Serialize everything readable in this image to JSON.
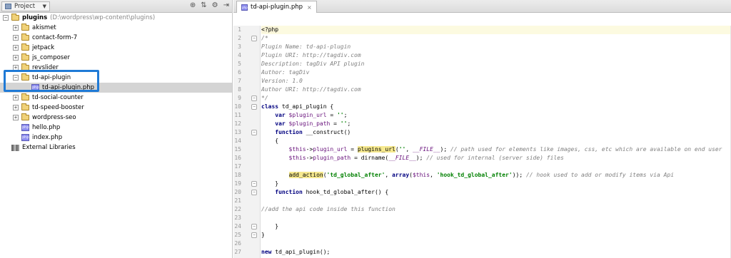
{
  "project_panel": {
    "title": "Project",
    "tree": [
      {
        "label": "plugins",
        "path": "(D:\\wordpress\\wp-content\\plugins)",
        "type": "folder",
        "expand": "-",
        "level": 0,
        "bold": true
      },
      {
        "label": "akismet",
        "type": "folder",
        "expand": "+",
        "level": 1
      },
      {
        "label": "contact-form-7",
        "type": "folder",
        "expand": "+",
        "level": 1
      },
      {
        "label": "jetpack",
        "type": "folder",
        "expand": "+",
        "level": 1
      },
      {
        "label": "js_composer",
        "type": "folder",
        "expand": "+",
        "level": 1
      },
      {
        "label": "revslider",
        "type": "folder",
        "expand": "+",
        "level": 1
      },
      {
        "label": "td-api-plugin",
        "type": "folder",
        "expand": "-",
        "level": 1
      },
      {
        "label": "td-api-plugin.php",
        "type": "php",
        "expand": "",
        "level": 2,
        "selected": true
      },
      {
        "label": "td-social-counter",
        "type": "folder",
        "expand": "+",
        "level": 1
      },
      {
        "label": "td-speed-booster",
        "type": "folder",
        "expand": "+",
        "level": 1
      },
      {
        "label": "wordpress-seo",
        "type": "folder",
        "expand": "+",
        "level": 1
      },
      {
        "label": "hello.php",
        "type": "php",
        "expand": "",
        "level": 1
      },
      {
        "label": "index.php",
        "type": "php",
        "expand": "",
        "level": 1
      },
      {
        "label": "External Libraries",
        "type": "lib",
        "expand": "",
        "level": 0
      }
    ]
  },
  "editor": {
    "tab_label": "td-api-plugin.php",
    "lines": [
      {
        "n": "1",
        "fold": "",
        "html": "<span class=\"phptag\">&lt;?php</span>"
      },
      {
        "n": "2",
        "fold": "-",
        "html": "<span class=\"cmt\">/*</span>"
      },
      {
        "n": "3",
        "fold": "",
        "html": "<span class=\"cmt\">Plugin Name: td-api-plugin</span>"
      },
      {
        "n": "4",
        "fold": "",
        "html": "<span class=\"cmt\">Plugin URI: http://tagdiv.com</span>"
      },
      {
        "n": "5",
        "fold": "",
        "html": "<span class=\"cmt\">Description: tagDiv API plugin</span>"
      },
      {
        "n": "6",
        "fold": "",
        "html": "<span class=\"cmt\">Author: tagDiv</span>"
      },
      {
        "n": "7",
        "fold": "",
        "html": "<span class=\"cmt\">Version: 1.0</span>"
      },
      {
        "n": "8",
        "fold": "",
        "html": "<span class=\"cmt\">Author URI: http://tagdiv.com</span>"
      },
      {
        "n": "9",
        "fold": "-",
        "html": "<span class=\"cmt\">*/</span>"
      },
      {
        "n": "10",
        "fold": "-",
        "html": "<span class=\"kw\">class</span> td_api_plugin {"
      },
      {
        "n": "11",
        "fold": "",
        "html": "    <span class=\"kw\">var</span> <span class=\"var\">$plugin_url</span> = <span class=\"str\">''</span>;"
      },
      {
        "n": "12",
        "fold": "",
        "html": "    <span class=\"kw\">var</span> <span class=\"var\">$plugin_path</span> = <span class=\"str\">''</span>;"
      },
      {
        "n": "13",
        "fold": "-",
        "html": "    <span class=\"kw\">function</span> __construct()"
      },
      {
        "n": "14",
        "fold": "",
        "html": "    {"
      },
      {
        "n": "15",
        "fold": "",
        "html": "        <span class=\"var\">$this</span>-&gt;<span class=\"var\">plugin_url</span> = <span class=\"fn-hl\">plugins_url</span>(<span class=\"str\">''</span>, <span class=\"const\">__FILE__</span>); <span class=\"cmt\">// path used for elements like images, css, etc which are available on end user</span>"
      },
      {
        "n": "16",
        "fold": "",
        "html": "        <span class=\"var\">$this</span>-&gt;<span class=\"var\">plugin_path</span> = dirname(<span class=\"const\">__FILE__</span>); <span class=\"cmt\">// used for internal (server side) files</span>"
      },
      {
        "n": "17",
        "fold": "",
        "html": ""
      },
      {
        "n": "18",
        "fold": "",
        "html": "        <span class=\"fn-hl\">add_action</span>(<span class=\"str\">'td_global_after'</span>, <span class=\"kw\">array</span>(<span class=\"var\">$this</span>, <span class=\"str\">'hook_td_global_after'</span>)); <span class=\"cmt\">// hook used to add or modify items via Api</span>"
      },
      {
        "n": "19",
        "fold": "-",
        "html": "    }"
      },
      {
        "n": "20",
        "fold": "-",
        "html": "    <span class=\"kw\">function</span> hook_td_global_after() {"
      },
      {
        "n": "21",
        "fold": "",
        "html": ""
      },
      {
        "n": "22",
        "fold": "",
        "html": "<span class=\"cmt\">//add the api code inside this function</span>"
      },
      {
        "n": "23",
        "fold": "",
        "html": ""
      },
      {
        "n": "24",
        "fold": "-",
        "html": "    }"
      },
      {
        "n": "25",
        "fold": "-",
        "html": "}"
      },
      {
        "n": "26",
        "fold": "",
        "html": ""
      },
      {
        "n": "27",
        "fold": "",
        "html": "<span class=\"kw\">new</span> td_api_plugin();"
      }
    ]
  }
}
